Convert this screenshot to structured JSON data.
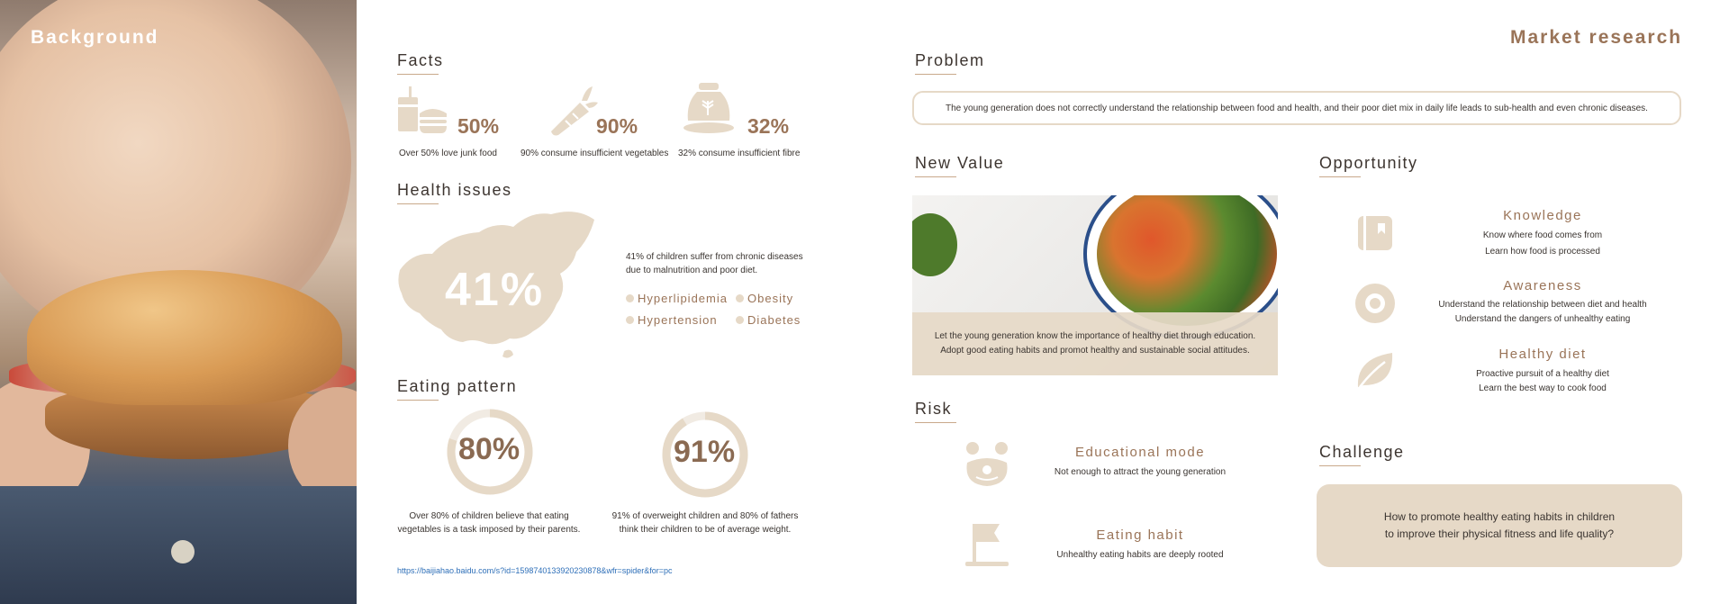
{
  "left_panel": {
    "title": "Background"
  },
  "header": {
    "right_title": "Market research"
  },
  "facts": {
    "title": "Facts",
    "items": [
      {
        "icon": "junk-food-icon",
        "value": "50%",
        "caption": "Over 50% love junk food"
      },
      {
        "icon": "carrot-icon",
        "value": "90%",
        "caption": "90% consume insufficient vegetables"
      },
      {
        "icon": "fibre-sack-icon",
        "value": "32%",
        "caption": "32% consume insufficient fibre"
      }
    ]
  },
  "health": {
    "title": "Health issues",
    "map_value": "41%",
    "text_line1": "41% of children suffer from chronic diseases",
    "text_line2": "due to malnutrition and poor diet.",
    "tags": [
      "Hyperlipidemia",
      "Obesity",
      "Hypertension",
      "Diabetes"
    ]
  },
  "eating": {
    "title": "Eating pattern",
    "rings": [
      {
        "value": "80%",
        "fraction": 0.8,
        "line1": "Over 80% of children believe that eating",
        "line2": "vegetables is a task imposed by their parents."
      },
      {
        "value": "91%",
        "fraction": 0.91,
        "line1": "91% of overweight children and 80% of fathers",
        "line2": "think their children to be of average weight."
      }
    ],
    "source_link": "https://baijiahao.baidu.com/s?id=1598740133920230878&wfr=spider&for=pc"
  },
  "problem": {
    "title": "Problem",
    "text": "The young generation does not correctly understand the relationship between food and health, and their poor diet mix in daily life leads to sub-health and even chronic diseases."
  },
  "new_value": {
    "title": "New Value",
    "line1": "Let the young generation know the importance of healthy diet through education.",
    "line2": "Adopt good eating habits and promot healthy and sustainable social attitudes."
  },
  "opportunity": {
    "title": "Opportunity",
    "items": [
      {
        "icon": "book-icon",
        "title": "Knowledge",
        "line1": "Know where food comes from",
        "line2": "Learn how food is processed"
      },
      {
        "icon": "eye-icon",
        "title": "Awareness",
        "line1": "Understand the relationship between diet and health",
        "line2": "Understand the dangers of unhealthy eating"
      },
      {
        "icon": "leaf-icon",
        "title": "Healthy diet",
        "line1": "Proactive pursuit of a healthy diet",
        "line2": "Learn the best way to cook food"
      }
    ]
  },
  "risk": {
    "title": "Risk",
    "items": [
      {
        "icon": "clown-icon",
        "title": "Educational mode",
        "desc": "Not enough to attract the young generation"
      },
      {
        "icon": "flag-icon",
        "title": "Eating habit",
        "desc": "Unhealthy eating habits are deeply rooted"
      }
    ]
  },
  "challenge": {
    "title": "Challenge",
    "line1": "How to promote healthy eating habits in children",
    "line2": "to improve their physical fitness and life quality?"
  },
  "colors": {
    "accent": "#9a7458",
    "beige": "#e6d9c7",
    "link": "#2e6fb8"
  }
}
